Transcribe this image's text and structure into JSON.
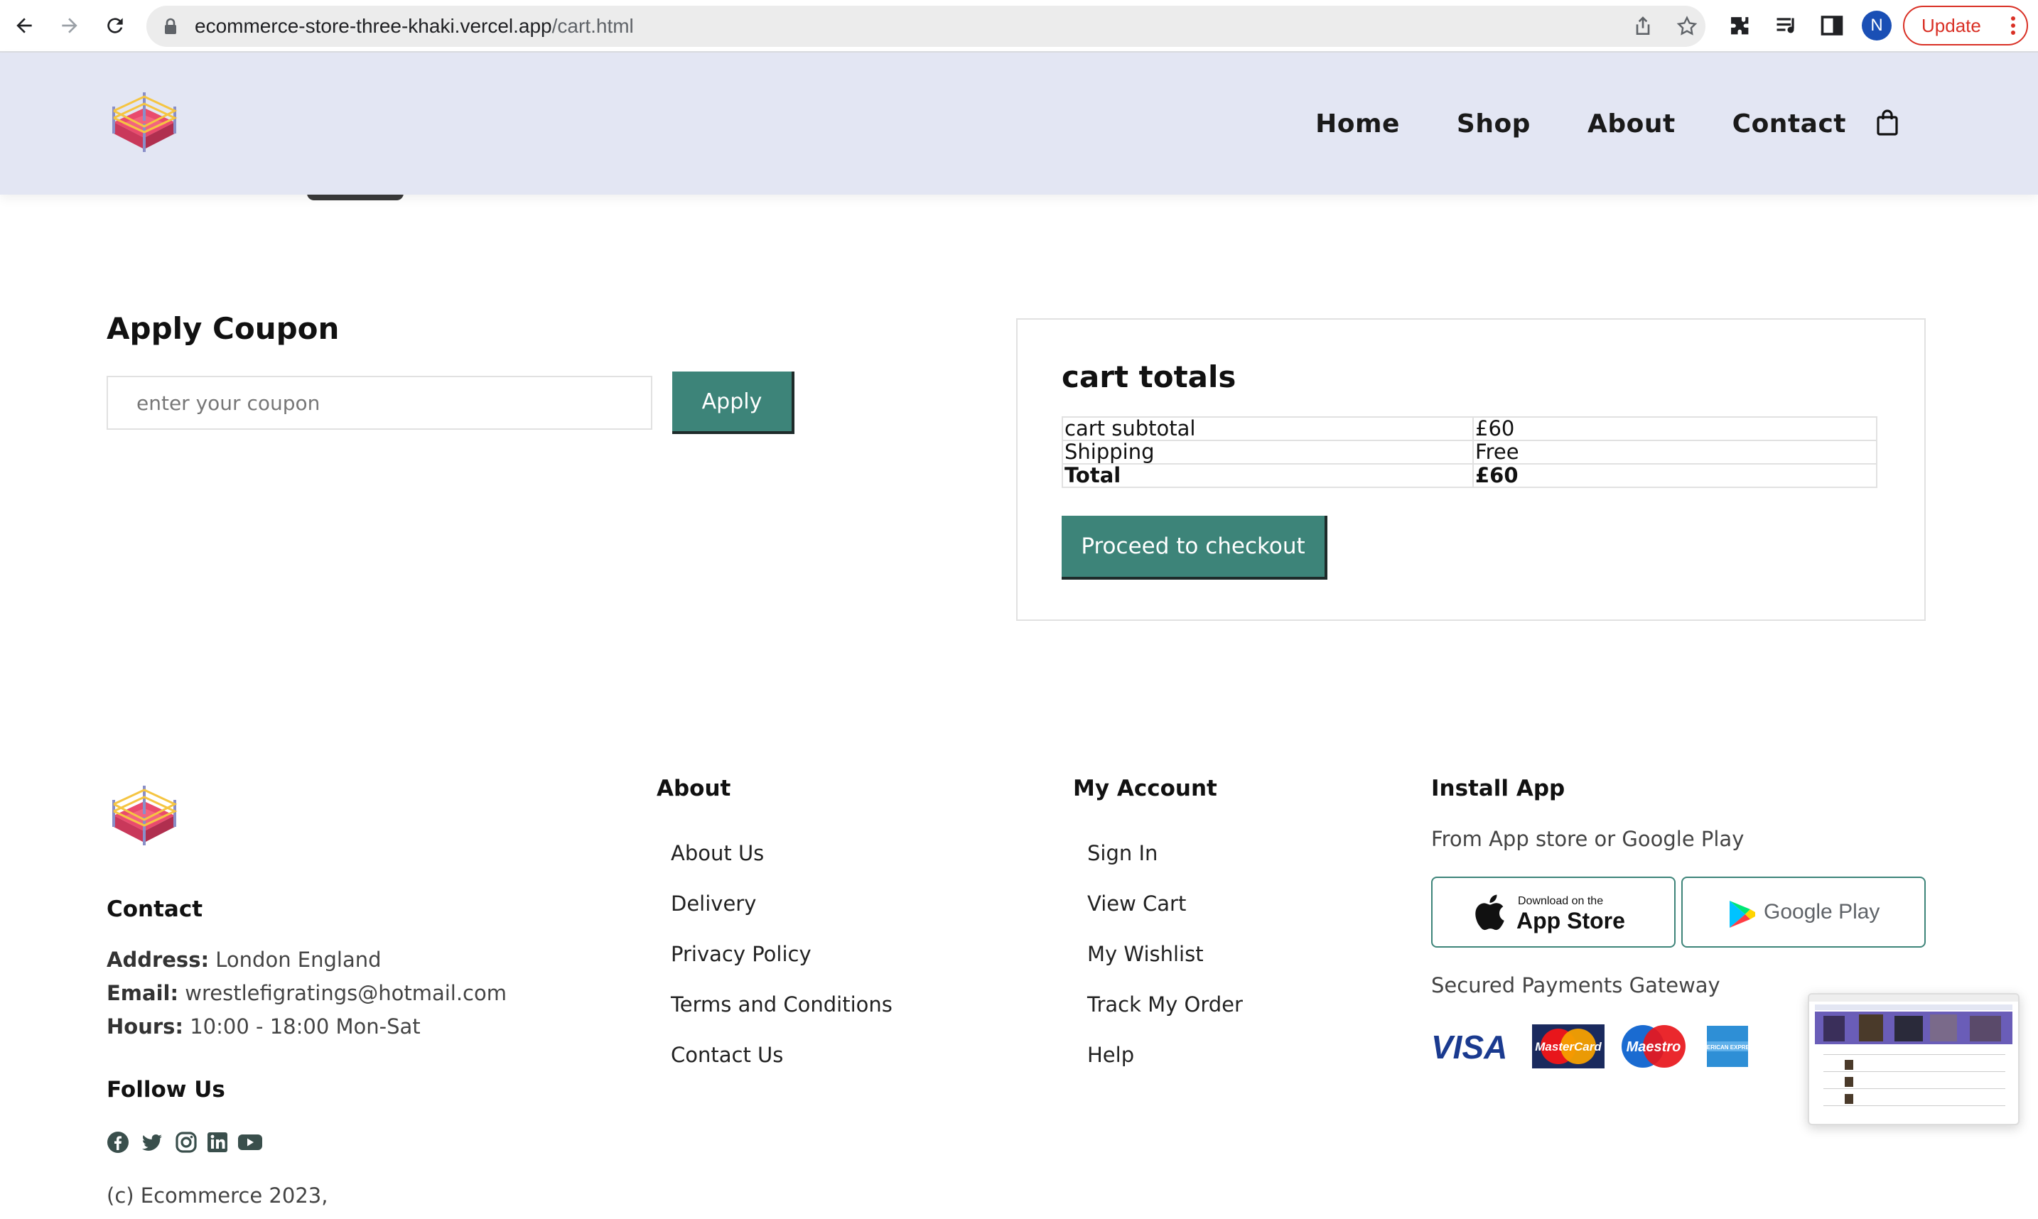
{
  "browser": {
    "url_domain": "ecommerce-store-three-khaki.vercel.app",
    "url_path": "/cart.html",
    "profile_initial": "N",
    "update_label": "Update"
  },
  "header": {
    "nav": [
      {
        "label": "Home"
      },
      {
        "label": "Shop"
      },
      {
        "label": "About"
      },
      {
        "label": "Contact"
      }
    ]
  },
  "coupon": {
    "title": "Apply Coupon",
    "placeholder": "enter your coupon",
    "apply_label": "Apply"
  },
  "totals": {
    "title": "cart totals",
    "rows": [
      {
        "label": "cart subtotal",
        "value": "£60"
      },
      {
        "label": "Shipping",
        "value": "Free"
      },
      {
        "label": "Total",
        "value": "£60"
      }
    ],
    "checkout_label": "Proceed to checkout"
  },
  "footer": {
    "contact": {
      "heading": "Contact",
      "address_label": "Address:",
      "address": "London England",
      "email_label": "Email:",
      "email": "wrestlefigratings@hotmail.com",
      "hours_label": "Hours:",
      "hours": "10:00 - 18:00 Mon-Sat"
    },
    "follow_heading": "Follow Us",
    "social_icons": [
      "facebook-icon",
      "twitter-icon",
      "instagram-icon",
      "linkedin-icon",
      "youtube-icon"
    ],
    "copyright": "(c) Ecommerce 2023,",
    "about": {
      "heading": "About",
      "links": [
        "About Us",
        "Delivery",
        "Privacy Policy",
        "Terms and Conditions",
        "Contact Us"
      ]
    },
    "account": {
      "heading": "My Account",
      "links": [
        "Sign In",
        "View Cart",
        "My Wishlist",
        "Track My Order",
        "Help"
      ]
    },
    "install": {
      "heading": "Install App",
      "subtitle": "From App store or Google Play",
      "appstore_small": "Download on the",
      "appstore_big": "App Store",
      "googleplay": "Google Play",
      "secured": "Secured Payments Gateway",
      "payment_logos": [
        "VISA",
        "MasterCard",
        "Maestro",
        "AMERICAN EXPRESS"
      ]
    }
  },
  "colors": {
    "header_bg": "#e3e6f3",
    "button_teal": "#3d8479",
    "update_red": "#d93025",
    "avatar_blue": "#1a4fb5"
  }
}
